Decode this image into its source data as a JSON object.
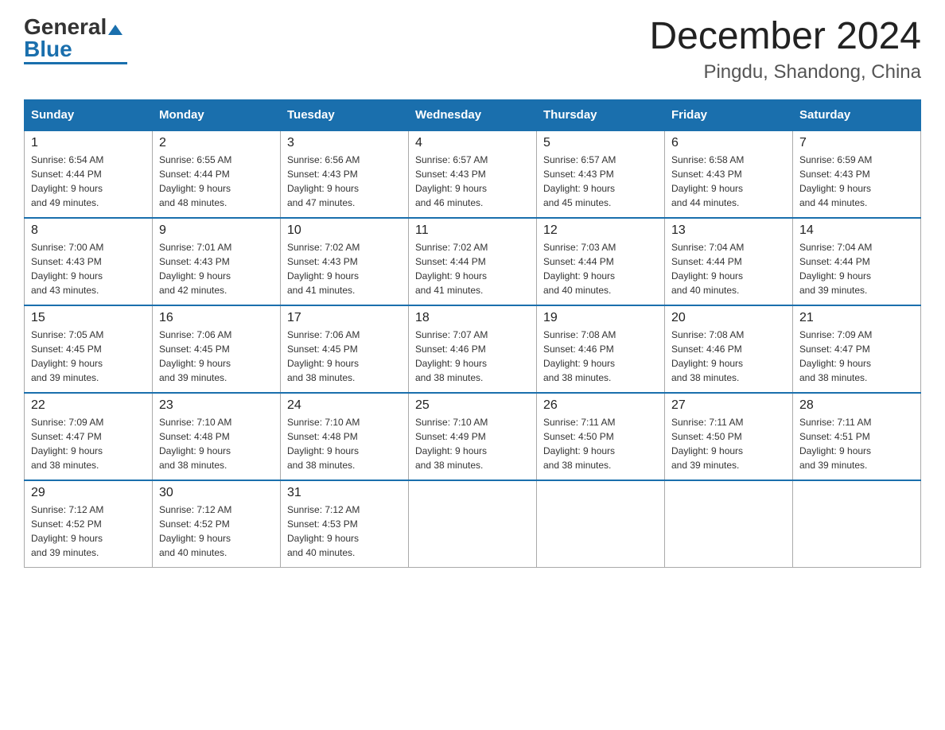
{
  "header": {
    "logo_general": "General",
    "logo_blue": "Blue",
    "month_title": "December 2024",
    "location": "Pingdu, Shandong, China"
  },
  "weekdays": [
    "Sunday",
    "Monday",
    "Tuesday",
    "Wednesday",
    "Thursday",
    "Friday",
    "Saturday"
  ],
  "weeks": [
    [
      {
        "day": "1",
        "sunrise": "6:54 AM",
        "sunset": "4:44 PM",
        "daylight": "9 hours and 49 minutes."
      },
      {
        "day": "2",
        "sunrise": "6:55 AM",
        "sunset": "4:44 PM",
        "daylight": "9 hours and 48 minutes."
      },
      {
        "day": "3",
        "sunrise": "6:56 AM",
        "sunset": "4:43 PM",
        "daylight": "9 hours and 47 minutes."
      },
      {
        "day": "4",
        "sunrise": "6:57 AM",
        "sunset": "4:43 PM",
        "daylight": "9 hours and 46 minutes."
      },
      {
        "day": "5",
        "sunrise": "6:57 AM",
        "sunset": "4:43 PM",
        "daylight": "9 hours and 45 minutes."
      },
      {
        "day": "6",
        "sunrise": "6:58 AM",
        "sunset": "4:43 PM",
        "daylight": "9 hours and 44 minutes."
      },
      {
        "day": "7",
        "sunrise": "6:59 AM",
        "sunset": "4:43 PM",
        "daylight": "9 hours and 44 minutes."
      }
    ],
    [
      {
        "day": "8",
        "sunrise": "7:00 AM",
        "sunset": "4:43 PM",
        "daylight": "9 hours and 43 minutes."
      },
      {
        "day": "9",
        "sunrise": "7:01 AM",
        "sunset": "4:43 PM",
        "daylight": "9 hours and 42 minutes."
      },
      {
        "day": "10",
        "sunrise": "7:02 AM",
        "sunset": "4:43 PM",
        "daylight": "9 hours and 41 minutes."
      },
      {
        "day": "11",
        "sunrise": "7:02 AM",
        "sunset": "4:44 PM",
        "daylight": "9 hours and 41 minutes."
      },
      {
        "day": "12",
        "sunrise": "7:03 AM",
        "sunset": "4:44 PM",
        "daylight": "9 hours and 40 minutes."
      },
      {
        "day": "13",
        "sunrise": "7:04 AM",
        "sunset": "4:44 PM",
        "daylight": "9 hours and 40 minutes."
      },
      {
        "day": "14",
        "sunrise": "7:04 AM",
        "sunset": "4:44 PM",
        "daylight": "9 hours and 39 minutes."
      }
    ],
    [
      {
        "day": "15",
        "sunrise": "7:05 AM",
        "sunset": "4:45 PM",
        "daylight": "9 hours and 39 minutes."
      },
      {
        "day": "16",
        "sunrise": "7:06 AM",
        "sunset": "4:45 PM",
        "daylight": "9 hours and 39 minutes."
      },
      {
        "day": "17",
        "sunrise": "7:06 AM",
        "sunset": "4:45 PM",
        "daylight": "9 hours and 38 minutes."
      },
      {
        "day": "18",
        "sunrise": "7:07 AM",
        "sunset": "4:46 PM",
        "daylight": "9 hours and 38 minutes."
      },
      {
        "day": "19",
        "sunrise": "7:08 AM",
        "sunset": "4:46 PM",
        "daylight": "9 hours and 38 minutes."
      },
      {
        "day": "20",
        "sunrise": "7:08 AM",
        "sunset": "4:46 PM",
        "daylight": "9 hours and 38 minutes."
      },
      {
        "day": "21",
        "sunrise": "7:09 AM",
        "sunset": "4:47 PM",
        "daylight": "9 hours and 38 minutes."
      }
    ],
    [
      {
        "day": "22",
        "sunrise": "7:09 AM",
        "sunset": "4:47 PM",
        "daylight": "9 hours and 38 minutes."
      },
      {
        "day": "23",
        "sunrise": "7:10 AM",
        "sunset": "4:48 PM",
        "daylight": "9 hours and 38 minutes."
      },
      {
        "day": "24",
        "sunrise": "7:10 AM",
        "sunset": "4:48 PM",
        "daylight": "9 hours and 38 minutes."
      },
      {
        "day": "25",
        "sunrise": "7:10 AM",
        "sunset": "4:49 PM",
        "daylight": "9 hours and 38 minutes."
      },
      {
        "day": "26",
        "sunrise": "7:11 AM",
        "sunset": "4:50 PM",
        "daylight": "9 hours and 38 minutes."
      },
      {
        "day": "27",
        "sunrise": "7:11 AM",
        "sunset": "4:50 PM",
        "daylight": "9 hours and 39 minutes."
      },
      {
        "day": "28",
        "sunrise": "7:11 AM",
        "sunset": "4:51 PM",
        "daylight": "9 hours and 39 minutes."
      }
    ],
    [
      {
        "day": "29",
        "sunrise": "7:12 AM",
        "sunset": "4:52 PM",
        "daylight": "9 hours and 39 minutes."
      },
      {
        "day": "30",
        "sunrise": "7:12 AM",
        "sunset": "4:52 PM",
        "daylight": "9 hours and 40 minutes."
      },
      {
        "day": "31",
        "sunrise": "7:12 AM",
        "sunset": "4:53 PM",
        "daylight": "9 hours and 40 minutes."
      },
      null,
      null,
      null,
      null
    ]
  ]
}
